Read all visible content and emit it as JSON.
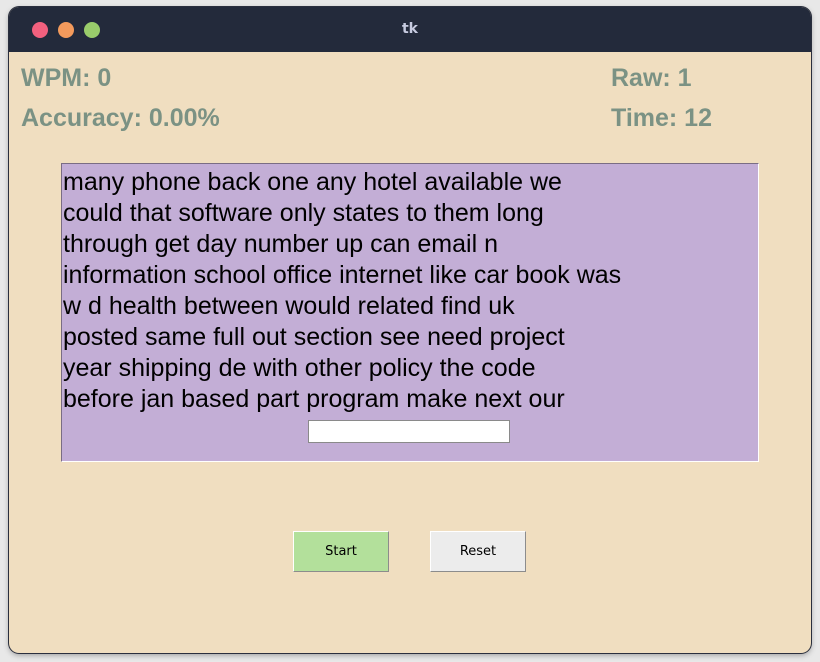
{
  "window": {
    "title": "tk"
  },
  "stats": {
    "wpm": "WPM: 0",
    "accuracy": "Accuracy: 0.00%",
    "raw": "Raw: 1",
    "time": "Time: 12"
  },
  "text_panel": {
    "lines": [
      "many phone back one any hotel available we",
      "could that software only states to them long",
      "through get day number up can email n",
      "information school office internet like car book was",
      "w d health between would related find uk",
      "posted same full out section see need project",
      "year shipping de with other policy the code",
      "before jan based part program make next our"
    ],
    "entry_value": ""
  },
  "buttons": {
    "start_label": "Start",
    "reset_label": "Reset"
  },
  "colors": {
    "background": "#f0dec0",
    "titlebar": "#232a3b",
    "stat_text": "#7b9284",
    "panel": "#c3aed6",
    "start_button": "#b3e09b",
    "reset_button": "#ececec"
  }
}
